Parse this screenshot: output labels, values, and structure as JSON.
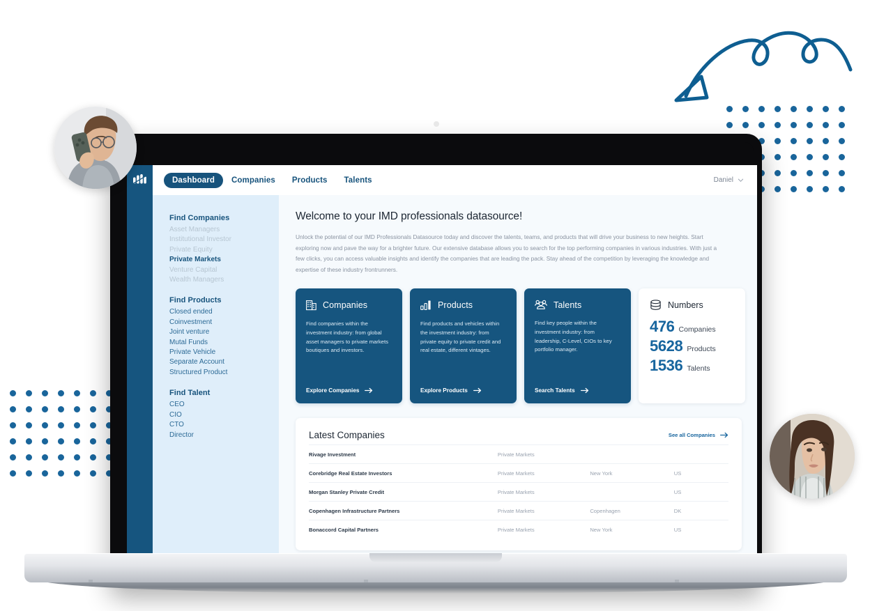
{
  "app": {
    "logo_name": "imd-logo",
    "nav": [
      {
        "label": "Dashboard",
        "active": true
      },
      {
        "label": "Companies",
        "active": false
      },
      {
        "label": "Products",
        "active": false
      },
      {
        "label": "Talents",
        "active": false
      }
    ],
    "user": {
      "name": "Daniel",
      "chevron_icon": "chevron-down-icon"
    }
  },
  "sidebar": {
    "groups": [
      {
        "heading": "Find Companies",
        "items": [
          {
            "label": "Asset Managers",
            "state": "muted"
          },
          {
            "label": "Institutional Investor",
            "state": "muted"
          },
          {
            "label": "Private Equity",
            "state": "muted"
          },
          {
            "label": "Private Markets",
            "state": "selected"
          },
          {
            "label": "Venture Capital",
            "state": "muted"
          },
          {
            "label": "Wealth Managers",
            "state": "muted"
          }
        ]
      },
      {
        "heading": "Find Products",
        "items": [
          {
            "label": "Closed ended",
            "state": "normal"
          },
          {
            "label": "Coinvestment",
            "state": "normal"
          },
          {
            "label": "Joint venture",
            "state": "normal"
          },
          {
            "label": "Mutal Funds",
            "state": "normal"
          },
          {
            "label": "Private Vehicle",
            "state": "normal"
          },
          {
            "label": "Separate Account",
            "state": "normal"
          },
          {
            "label": "Structured Product",
            "state": "normal"
          }
        ]
      },
      {
        "heading": "Find Talent",
        "items": [
          {
            "label": "CEO",
            "state": "normal"
          },
          {
            "label": "CIO",
            "state": "normal"
          },
          {
            "label": "CTO",
            "state": "normal"
          },
          {
            "label": "Director",
            "state": "normal"
          }
        ]
      }
    ]
  },
  "main": {
    "heading": "Welcome to your IMD professionals datasource!",
    "intro": "Unlock the potential of our IMD Professionals Datasource today and discover the talents, teams, and products that will drive your business to new heights. Start exploring now and pave the way for a brighter future. Our extensive database allows you to search for the top performing companies in various industries. With just a few clicks, you can access valuable insights and identify the companies that are leading the pack. Stay ahead of the competition by leveraging the knowledge and expertise of these industry frontrunners.",
    "cards": [
      {
        "icon": "building-icon",
        "title": "Companies",
        "description": "Find companies within the investment industry: from global asset managers to private markets boutiques and investors.",
        "cta": "Explore Companies"
      },
      {
        "icon": "bar-chart-icon",
        "title": "Products",
        "description": "Find products and vehicles within the investment industry: from private equity to private credit and real estate, different vintages.",
        "cta": "Explore Products"
      },
      {
        "icon": "people-group-icon",
        "title": "Talents",
        "description": "Find key people within the investment industry: from leadership, C-Level, CIOs to key portfolio manager.",
        "cta": "Search Talents"
      }
    ],
    "numbers": {
      "icon": "database-icon",
      "title": "Numbers",
      "stats": [
        {
          "value": "476",
          "label": "Companies"
        },
        {
          "value": "5628",
          "label": "Products"
        },
        {
          "value": "1536",
          "label": "Talents"
        }
      ]
    },
    "latest": {
      "title": "Latest Companies",
      "see_all": "See all Companies",
      "see_all_icon": "arrow-right-icon",
      "rows": [
        {
          "name": "Rivage Investment",
          "type": "Private Markets",
          "city": "",
          "country": ""
        },
        {
          "name": "Corebridge Real Estate Investors",
          "type": "Private Markets",
          "city": "New York",
          "country": "US"
        },
        {
          "name": "Morgan Stanley Private Credit",
          "type": "Private Markets",
          "city": "",
          "country": "US"
        },
        {
          "name": "Copenhagen Infrastructure Partners",
          "type": "Private Markets",
          "city": "Copenhagen",
          "country": "DK"
        },
        {
          "name": "Bonaccord Capital Partners",
          "type": "Private Markets",
          "city": "New York",
          "country": "US"
        }
      ]
    }
  },
  "decorations": {
    "arrow_doodle": "curved-arrow-doodle",
    "dot_grid_right": {
      "name": "dot-grid-right",
      "cols": 8,
      "rows": 6,
      "spacing": 23,
      "color": "#19659b"
    },
    "dot_grid_left": {
      "name": "dot-grid-left",
      "cols": 7,
      "rows": 6,
      "spacing": 23,
      "color": "#19659b"
    },
    "avatar_man": "avatar-man-on-phone",
    "avatar_woman": "avatar-woman-portrait"
  },
  "colors": {
    "brand_dark": "#16557f",
    "brand_accent": "#17659e",
    "sidebar_bg": "#dfeefa",
    "content_bg": "#f6fafd",
    "doodle": "#0e5e91"
  }
}
